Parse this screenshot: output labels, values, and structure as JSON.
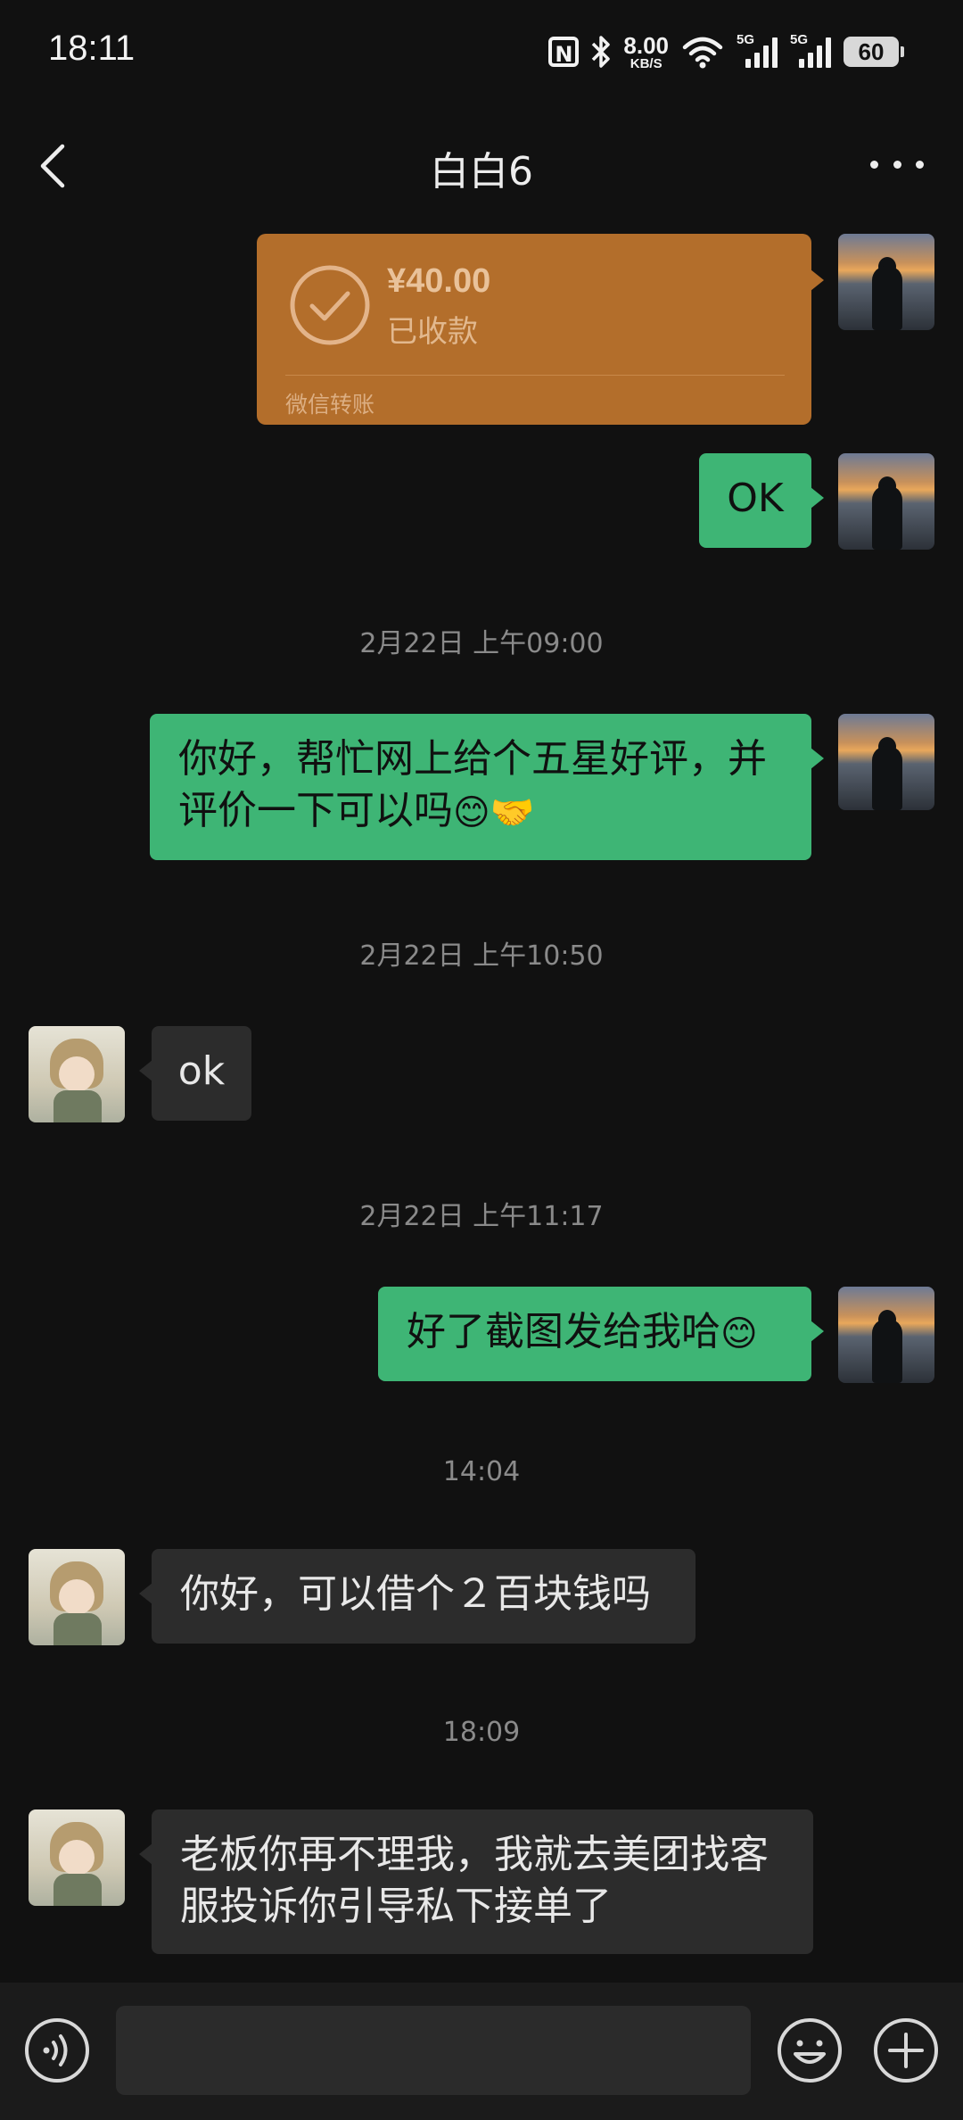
{
  "status_bar": {
    "time": "18:11",
    "speed_value": "8.00",
    "speed_unit": "KB/S",
    "sim1": "5G",
    "sim2": "5G",
    "battery": "60"
  },
  "header": {
    "title": "白白6"
  },
  "messages": [
    {
      "type": "transfer",
      "amount": "¥40.00",
      "status": "已收款",
      "footer": "微信转账"
    },
    {
      "type": "sent",
      "text": "OK"
    },
    {
      "type": "time",
      "text": "2月22日 上午09:00"
    },
    {
      "type": "sent",
      "line1": "你好，帮忙网上给个五星好评，并",
      "line2": "评价一下可以吗",
      "emoji": "😊🤝"
    },
    {
      "type": "time",
      "text": "2月22日 上午10:50"
    },
    {
      "type": "received",
      "text": "ok"
    },
    {
      "type": "time",
      "text": "2月22日 上午11:17"
    },
    {
      "type": "sent",
      "text": "好了截图发给我哈",
      "emoji": "😊"
    },
    {
      "type": "time",
      "text": "14:04"
    },
    {
      "type": "received",
      "text": "你好，可以借个２百块钱吗"
    },
    {
      "type": "time",
      "text": "18:09"
    },
    {
      "type": "received",
      "line1": "老板你再不理我，我就去美团找客",
      "line2": "服投诉你引导私下接单了"
    }
  ],
  "input": {
    "placeholder": ""
  },
  "icons": {
    "back": "chevron-left-icon",
    "more": "more-icon",
    "voice": "voice-icon",
    "emoji": "emoji-icon",
    "plus": "plus-icon"
  },
  "colors": {
    "background": "#111111",
    "sent_bubble": "#3eb575",
    "received_bubble": "#2c2c2c",
    "transfer_card": "#b36e2b"
  }
}
